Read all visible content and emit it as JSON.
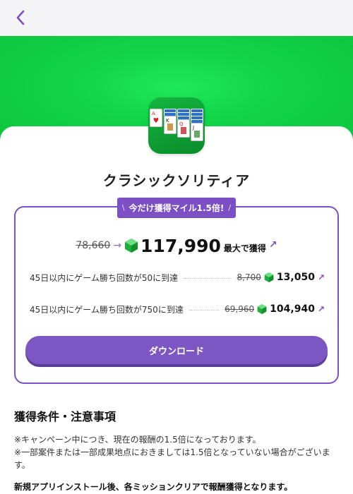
{
  "app": {
    "title": "クラシックソリティア"
  },
  "campaign": {
    "badge_left": "\\",
    "badge_text": "今だけ獲得マイル1.5倍!",
    "badge_right": "/"
  },
  "reward": {
    "old_total": "78,660",
    "new_total": "117,990",
    "suffix": "最大で獲得"
  },
  "missions": [
    {
      "label": "45日以内にゲーム勝ち回数が50に到達",
      "old": "8,700",
      "new": "13,050"
    },
    {
      "label": "45日以内にゲーム勝ち回数が750に到達",
      "old": "69,960",
      "new": "104,940"
    }
  ],
  "download_label": "ダウンロード",
  "conditions": {
    "title": "獲得条件・注意事項",
    "note1": "※キャンペーン中につき、現在の報酬の1.5倍になっております。",
    "note2": "※一部案件または一部成果地点におきましては1.5倍となっていない場合がございます。",
    "note3": "新規アプリインストール後、各ミッションクリアで報酬獲得となります。"
  },
  "colors": {
    "accent": "#7c4fc4",
    "hero_green": "#12d448",
    "gem": "#2bc04a"
  },
  "icons": {
    "back": "chevron-left-icon",
    "gem": "gem-icon",
    "arrow": "arrow-up-right-icon"
  }
}
